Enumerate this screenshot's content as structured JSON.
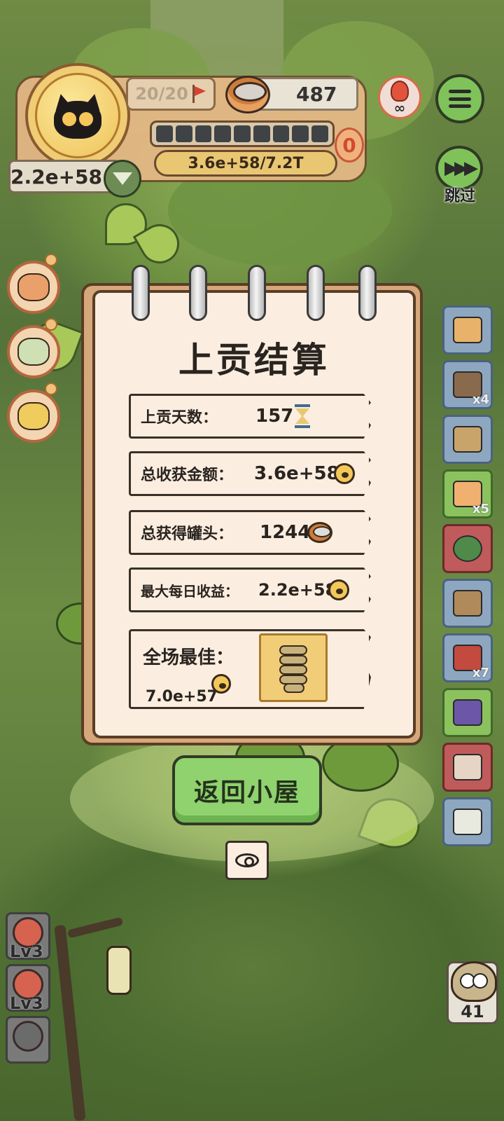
{
  "hud": {
    "level": "20/20",
    "cans": "487",
    "experience": "3.6e+58/7.2T",
    "stage_badge": "0",
    "gold": "2.2e+58",
    "skip_label": "跳过"
  },
  "modal": {
    "title": "上贡结算",
    "rows": [
      {
        "label": "上贡天数：",
        "value": "157",
        "icon": "hourglass-icon"
      },
      {
        "label": "总收获金额：",
        "value": "3.6e+58",
        "icon": "paw-coin-icon"
      },
      {
        "label": "总获得罐头：",
        "value": "1244",
        "icon": "can-icon"
      },
      {
        "label": "最大每日收益：",
        "value": "2.2e+58",
        "icon": "paw-coin-icon"
      }
    ],
    "best": {
      "label": "全场最佳：",
      "value": "7.0e+57"
    },
    "return_button": "返回小屋"
  },
  "right_tiles": [
    {
      "icon": "hamster-food-icon",
      "count": ""
    },
    {
      "icon": "shop-stall-icon",
      "count": "x4"
    },
    {
      "icon": "hut-icon",
      "count": ""
    },
    {
      "icon": "ticket-icon",
      "count": "x5"
    },
    {
      "icon": "melon-icon",
      "count": ""
    },
    {
      "icon": "box-icon",
      "count": ""
    },
    {
      "icon": "meat-icon",
      "count": "x7"
    },
    {
      "icon": "card-icon",
      "count": ""
    },
    {
      "icon": "pet-icon",
      "count": ""
    },
    {
      "icon": "leaf-icon",
      "count": ""
    }
  ],
  "left_levels": [
    {
      "label": "Lv3"
    },
    {
      "label": "Lv3"
    }
  ],
  "owl_count": "41",
  "colors": {
    "button_green": "#8fd26e",
    "paper": "#fbeee0",
    "frame_brown": "#5a3d25"
  }
}
